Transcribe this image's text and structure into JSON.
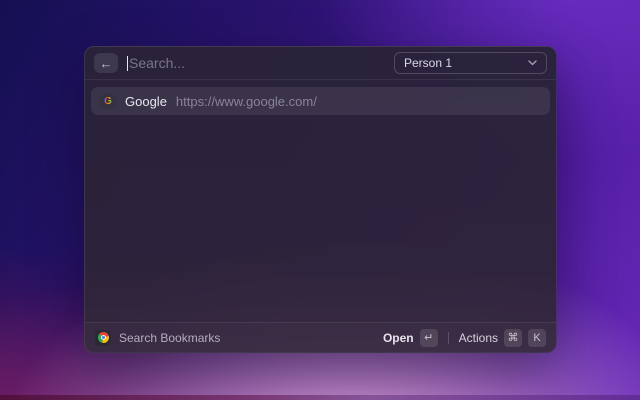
{
  "header": {
    "back_button": {
      "icon": "←"
    },
    "search": {
      "placeholder": "Search...",
      "value": ""
    },
    "profile_dropdown": {
      "value": "Person 1"
    }
  },
  "list": {
    "items": [
      {
        "title": "Google",
        "url": "https://www.google.com/",
        "favicon_letter": "G",
        "selected": true
      }
    ]
  },
  "footer": {
    "source_label": "Search Bookmarks",
    "open_label": "Open",
    "open_key": "↵",
    "actions_label": "Actions",
    "actions_keys": [
      "⌘",
      "K"
    ]
  },
  "colors": {
    "google_blue": "#4285F4",
    "google_red": "#EA4335",
    "google_yellow": "#FBBC05",
    "google_green": "#34A853",
    "background_navy": "#141052",
    "background_purple": "#5b21a8",
    "background_pink_glow": "#e5b0e0",
    "window_bg": "#2a2339",
    "selected_row_bg": "#453e57"
  }
}
